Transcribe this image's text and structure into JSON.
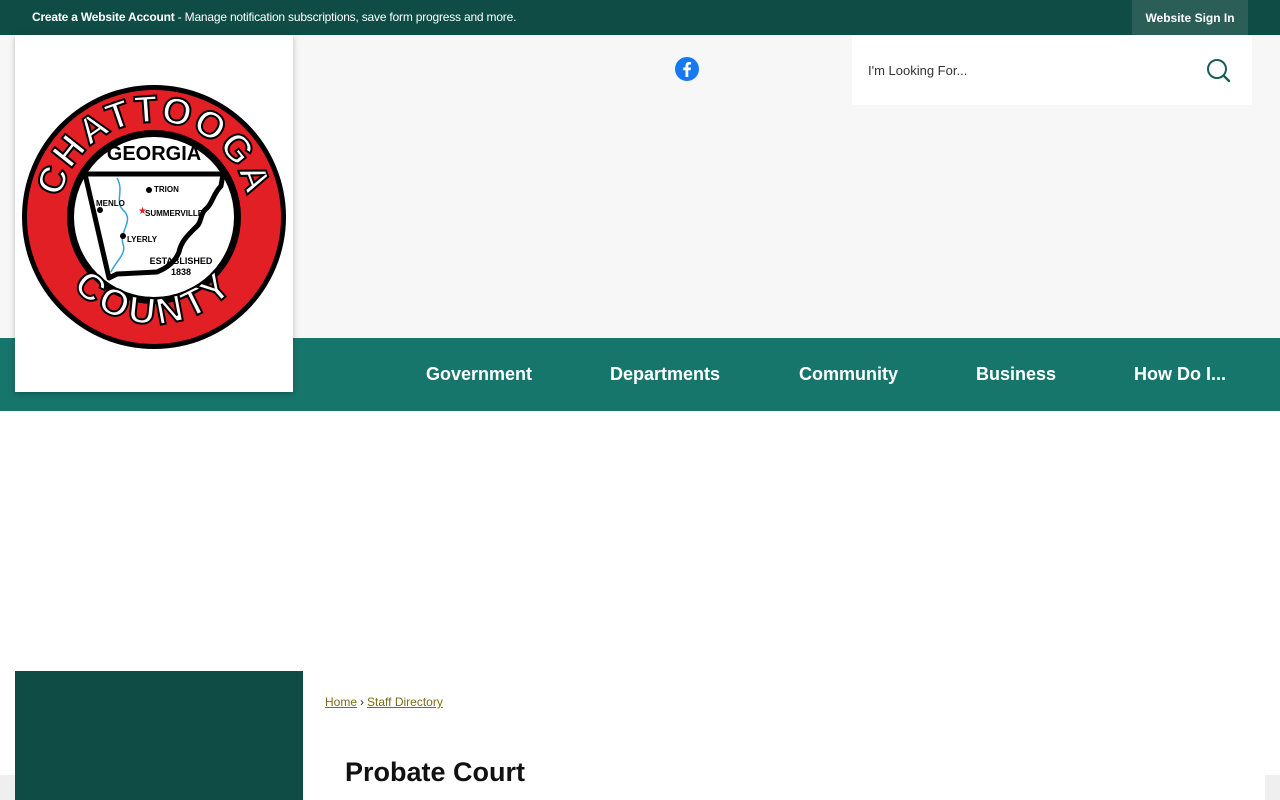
{
  "topbar": {
    "create_account_label": "Create a Website Account",
    "message": " - Manage notification subscriptions, save form progress and more.",
    "signin_label": "Website Sign In"
  },
  "logo": {
    "ring_top_text": "CHATTOOGA",
    "ring_bottom_text": "COUNTY",
    "state_text": "GEORGIA",
    "towns": [
      "TRION",
      "MENLO",
      "SUMMERVILLE",
      "LYERLY"
    ],
    "established": "ESTABLISHED",
    "year": "1838",
    "colors": {
      "ring": "#e31f26",
      "outline": "#000000",
      "river": "#3aa0d8"
    }
  },
  "social": {
    "facebook_icon": "facebook-icon"
  },
  "search": {
    "placeholder": "I'm Looking For...",
    "icon": "search-icon"
  },
  "nav": {
    "items": [
      {
        "label": "Government"
      },
      {
        "label": "Departments"
      },
      {
        "label": "Community"
      },
      {
        "label": "Business"
      },
      {
        "label": "How Do I..."
      }
    ]
  },
  "breadcrumb": {
    "home": "Home",
    "separator": "›",
    "current": "Staff Directory"
  },
  "page": {
    "title": "Probate Court"
  },
  "colors": {
    "topbar": "#0f4c45",
    "nav": "#17766c",
    "sidebar": "#0f4c45",
    "link": "#7d6a1b"
  }
}
